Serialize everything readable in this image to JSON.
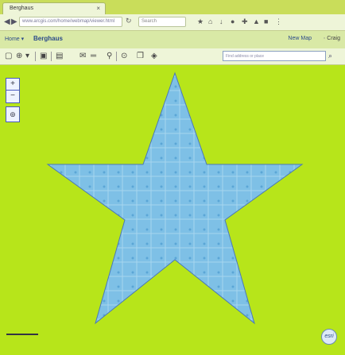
{
  "browser": {
    "tab_title": "Berghaus",
    "url": "www.arcgis.com/home/webmap/viewer.html",
    "search_placeholder": "Search"
  },
  "app": {
    "home_label": "Home ▾",
    "place_title": "Berghaus",
    "new_map_label": "New Map",
    "user_label": "Craig"
  },
  "map": {
    "search_placeholder": "Find address or place",
    "zoom_in": "+",
    "zoom_out": "−",
    "scale_label": "",
    "attribution": "esri"
  },
  "colors": {
    "background": "#b7e51a",
    "star_fill": "#7ec0e6",
    "star_stroke": "#4a78b8"
  }
}
